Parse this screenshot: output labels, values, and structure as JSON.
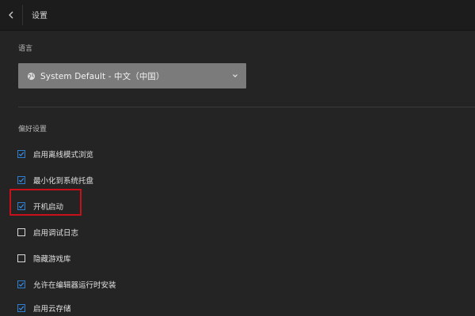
{
  "header": {
    "title": "设置",
    "back_icon": "chevron-left-icon"
  },
  "language": {
    "label": "语言",
    "selected": "System Default - 中文（中国）",
    "icon": "globe-icon"
  },
  "preferences": {
    "label": "偏好设置",
    "options": [
      {
        "label": "启用离线模式浏览",
        "checked": true
      },
      {
        "label": "最小化到系统托盘",
        "checked": true
      },
      {
        "label": "开机启动",
        "checked": true,
        "highlighted": true
      },
      {
        "label": "启用调试日志",
        "checked": false
      },
      {
        "label": "隐藏游戏库",
        "checked": false
      },
      {
        "label": "允许在编辑器运行时安装",
        "checked": true
      },
      {
        "label": "启用云存储",
        "checked": true
      }
    ]
  },
  "colors": {
    "background": "#242424",
    "topbar": "#1c1c1c",
    "select_bg": "#7b7b7b",
    "checkbox_accent": "#2f7fd0",
    "highlight_box": "#c8101a"
  }
}
